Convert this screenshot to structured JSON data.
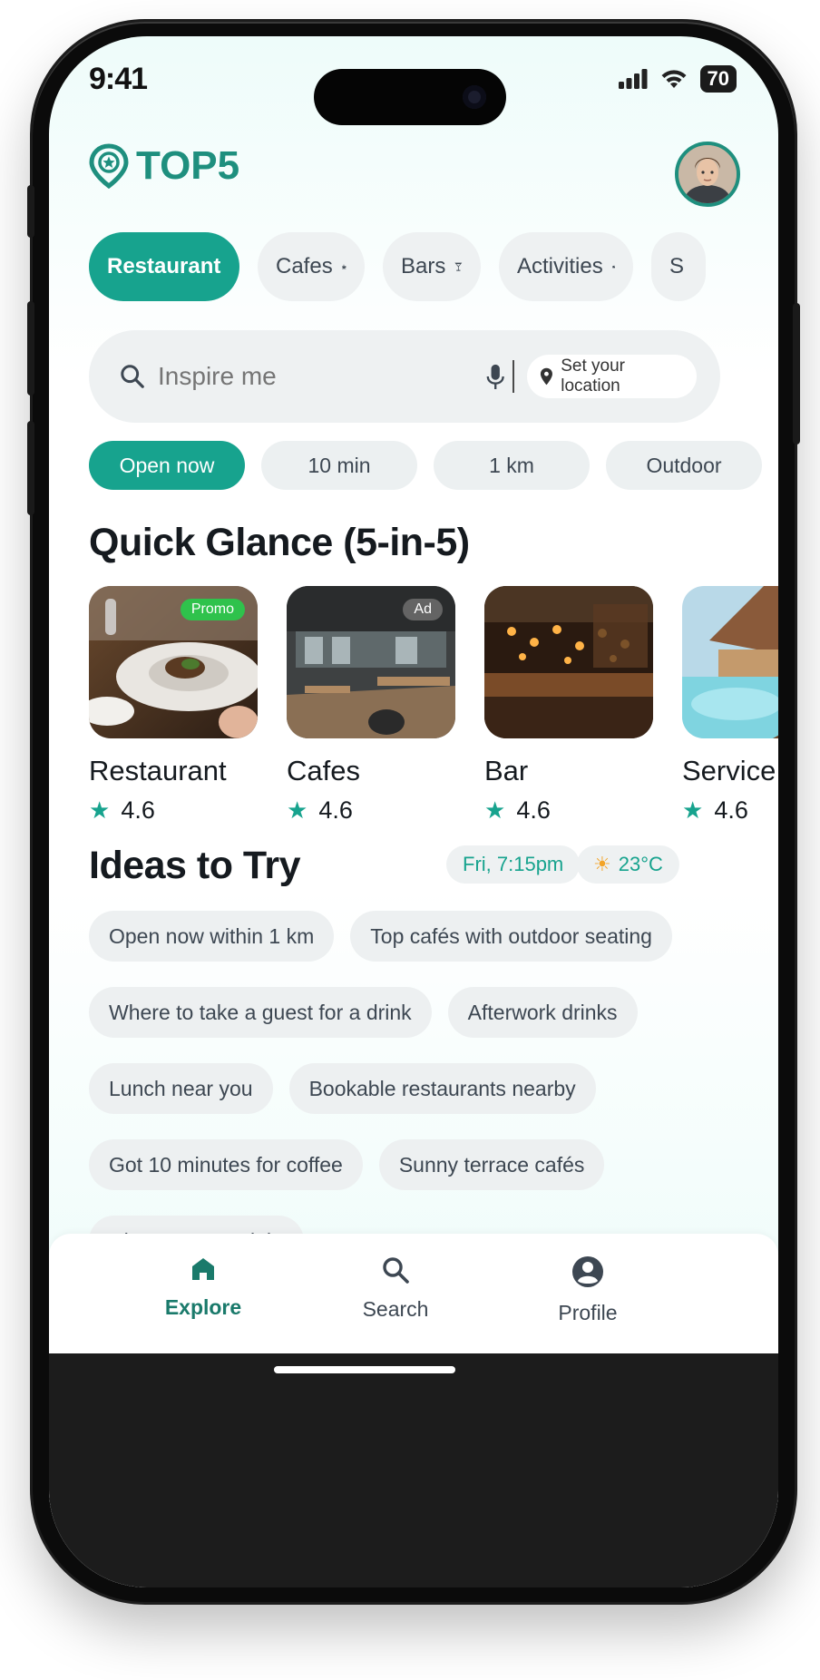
{
  "status": {
    "time": "9:41",
    "battery": "70"
  },
  "header": {
    "logo_text": "TOP5"
  },
  "categories": [
    {
      "label": "Restaurant",
      "icon": "fork-knife-icon",
      "active": true
    },
    {
      "label": "Cafes",
      "icon": "coffee-cup-icon",
      "active": false
    },
    {
      "label": "Bars",
      "icon": "cocktail-icon",
      "active": false
    },
    {
      "label": "Activities",
      "icon": "ticket-icon",
      "active": false
    },
    {
      "label": "S",
      "icon": "",
      "active": false
    }
  ],
  "search": {
    "placeholder": "Inspire me",
    "location_label": "Set your location"
  },
  "filters": [
    {
      "label": "Open now",
      "active": true
    },
    {
      "label": "10 min",
      "active": false
    },
    {
      "label": "1 km",
      "active": false
    },
    {
      "label": "Outdoor",
      "active": false
    }
  ],
  "quick_glance": {
    "title": "Quick Glance (5-in-5)",
    "cards": [
      {
        "name": "Restaurant",
        "rating": "4.6",
        "badge": "Promo"
      },
      {
        "name": "Cafes",
        "rating": "4.6",
        "badge": "Ad"
      },
      {
        "name": "Bar",
        "rating": "4.6",
        "badge": ""
      },
      {
        "name": "Service",
        "rating": "4.6",
        "badge": ""
      }
    ]
  },
  "ideas": {
    "title": "Ideas to Try",
    "datetime": "Fri, 7:15pm",
    "weather": "23°C",
    "rows": [
      [
        "Open now within 1 km",
        "Top cafés with outdoor seating"
      ],
      [
        "Where to take a guest for a drink",
        "Afterwork drinks"
      ],
      [
        "Lunch near you",
        "Bookable restaurants nearby"
      ],
      [
        "Got 10 minutes for coffee",
        "Sunny terrace cafés"
      ],
      [
        "Cheap eats tonight"
      ]
    ]
  },
  "nav": {
    "explore": "Explore",
    "search": "Search",
    "profile": "Profile"
  },
  "colors": {
    "accent": "#17a38e",
    "brand": "#1e8f7e",
    "promo": "#2fc24c"
  }
}
